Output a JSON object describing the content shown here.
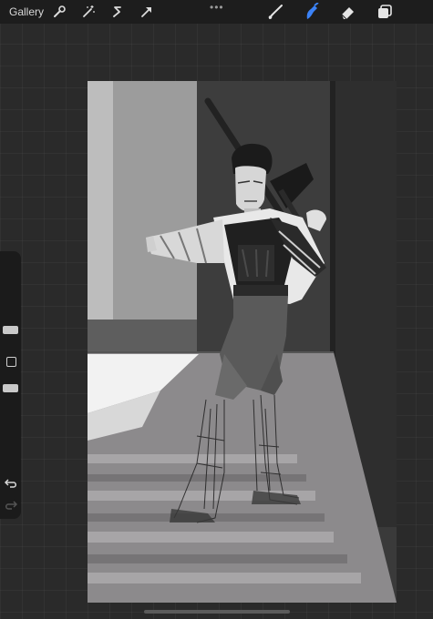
{
  "topbar": {
    "gallery_label": "Gallery",
    "more_label": "•••",
    "tools_left": [
      "wrench-icon",
      "magic-wand-icon",
      "selection-s-icon",
      "transform-arrow-icon"
    ],
    "tools_right": [
      "brush-icon",
      "smudge-icon",
      "eraser-icon",
      "layers-icon"
    ],
    "active_tool": "smudge-icon",
    "accent_color": "#3b82f6"
  },
  "sidebar": {
    "size_slider": 0.35,
    "opacity_slider": 0.55,
    "undo_icon": "undo-icon",
    "redo_icon": "redo-icon"
  }
}
